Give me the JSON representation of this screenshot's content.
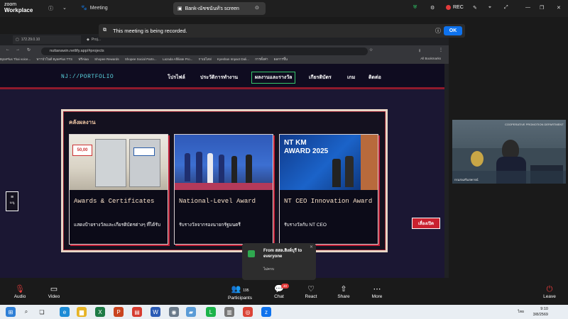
{
  "zoom": {
    "logo_line1": "zoom",
    "logo_line2": "Workplace",
    "meeting_label": "Meeting",
    "share_tab": "Bank-ณัชชนันท์'s screen",
    "rec_label": "REC",
    "banner_text": "This meeting is being recorded.",
    "banner_ok": "OK"
  },
  "browser": {
    "tabs": [
      "172.29.0.10",
      "Proj..."
    ],
    "url": "nuttanawin.netlify.app/#projects",
    "bookmarks": [
      "BytePlus Thai voice...",
      "พาาบัวโนด์ BytePlus TTS",
      "ฟรีAlaa",
      "Shopee Rewards",
      "Shopee Social Partn...",
      "Lazada Affiliate Pro...",
      "กาเม่ไลฟ",
      "Kyeshan Impact Dali...",
      "การตั้งค่า",
      "ผลการขึ้น"
    ],
    "all_bookmarks": "All Bookmarks"
  },
  "portfolio": {
    "brand": "NJ://PORTFOLIO",
    "nav": [
      "โปรไฟล์",
      "ประวัติการทำงาน",
      "ผลงานและรางวัล",
      "เกียรติบัตร",
      "เกม",
      "ติดต่อ"
    ],
    "section_title": "คลังผลงาน",
    "cards": [
      {
        "title": "Awards & Certificates",
        "desc": "แสดงป้ายรางวัลและเกียรติบัตรต่างๆ ที่ได้รับ"
      },
      {
        "title": "National-Level Award",
        "desc": "รับรางวัลจากรองนายกรัฐมนตรี"
      },
      {
        "title": "NT CEO Innovation Award",
        "desc": "รับรางวัลกับ NT CEO"
      }
    ],
    "card_image_text": [
      "50,00",
      "NT KM AWARD 2025"
    ],
    "side_menu": "เมนู",
    "open_button": "เลื่องเปิด"
  },
  "chat": {
    "from": "From สสล.สิงห์บุรี to everyone",
    "message": "ไม่ครบ"
  },
  "video": {
    "banner": "COOPERATIVE PROMOTION DEPARTMENT",
    "caption": "กรมส่งเสริมสหกรณ์"
  },
  "toolbar": {
    "audio": "Audio",
    "video": "Video",
    "participants": "Participants",
    "participants_count": "195",
    "chat": "Chat",
    "chat_badge": "40",
    "react": "React",
    "share": "Share",
    "more": "More",
    "leave": "Leave"
  },
  "taskbar": {
    "time": "9:10",
    "date": "3/8/2569",
    "lang": "ไทย"
  }
}
